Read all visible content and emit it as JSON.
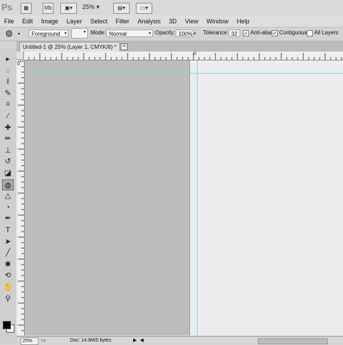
{
  "appbar": {
    "logo": "Ps",
    "mini_bridge": "Mb",
    "zoom": "25%"
  },
  "menu": [
    "File",
    "Edit",
    "Image",
    "Layer",
    "Select",
    "Filter",
    "Analysis",
    "3D",
    "View",
    "Window",
    "Help"
  ],
  "options": {
    "fill_source": "Foreground",
    "mode_label": "Mode:",
    "mode_value": "Normal",
    "opacity_label": "Opacity:",
    "opacity_value": "100%",
    "tolerance_label": "Tolerance:",
    "tolerance_value": "32",
    "anti_alias_label": "Anti-alias",
    "anti_alias_checked": true,
    "contiguous_label": "Contiguous",
    "contiguous_checked": true,
    "all_layers_label": "All Layers",
    "all_layers_checked": false
  },
  "document_tab": {
    "title": "Untitled-1 @ 25% (Layer 1, CMYK/8) *",
    "close": "×"
  },
  "ruler": {
    "top_labels": [
      "0"
    ],
    "left_labels": [
      "0"
    ]
  },
  "status": {
    "zoom": "25%",
    "doc_info": "Doc: 14.9M/0 bytes"
  },
  "tools": [
    {
      "name": "move-tool-icon",
      "glyph": "▸"
    },
    {
      "name": "marquee-tool-icon",
      "glyph": "◌"
    },
    {
      "name": "lasso-tool-icon",
      "glyph": "ℓ"
    },
    {
      "name": "quick-selection-tool-icon",
      "glyph": "✎"
    },
    {
      "name": "crop-tool-icon",
      "glyph": "⌗"
    },
    {
      "name": "eyedropper-tool-icon",
      "glyph": "⁄"
    },
    {
      "name": "healing-brush-tool-icon",
      "glyph": "✚"
    },
    {
      "name": "brush-tool-icon",
      "glyph": "✏"
    },
    {
      "name": "clone-stamp-tool-icon",
      "glyph": "⊥"
    },
    {
      "name": "history-brush-tool-icon",
      "glyph": "↺"
    },
    {
      "name": "eraser-tool-icon",
      "glyph": "◪"
    },
    {
      "name": "paint-bucket-tool-icon",
      "glyph": "◍"
    },
    {
      "name": "blur-tool-icon",
      "glyph": "△"
    },
    {
      "name": "dodge-tool-icon",
      "glyph": "◔"
    },
    {
      "name": "pen-tool-icon",
      "glyph": "✒"
    },
    {
      "name": "type-tool-icon",
      "glyph": "T"
    },
    {
      "name": "path-selection-tool-icon",
      "glyph": "➤"
    },
    {
      "name": "line-tool-icon",
      "glyph": "╱"
    },
    {
      "name": "3d-rotate-tool-icon",
      "glyph": "✺"
    },
    {
      "name": "3d-orbit-tool-icon",
      "glyph": "⟲"
    },
    {
      "name": "hand-tool-icon",
      "glyph": "✋"
    },
    {
      "name": "zoom-tool-icon",
      "glyph": "⚲"
    }
  ],
  "colors": {
    "guide": "#7fd8e0",
    "pasteboard": "#bdbdbd",
    "document": "#ececef"
  }
}
